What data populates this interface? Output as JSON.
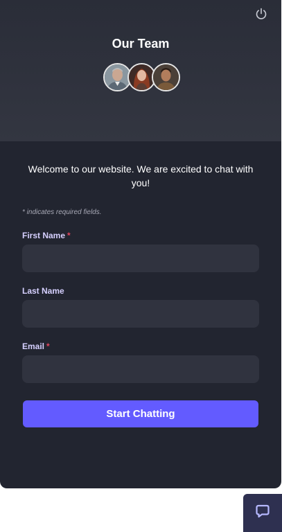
{
  "header": {
    "title": "Our Team",
    "power_icon": "power-icon"
  },
  "welcome_text": "Welcome to our website. We are excited to chat with you!",
  "required_note": "* indicates required fields.",
  "form": {
    "first_name": {
      "label": "First Name",
      "required_mark": "*",
      "value": "",
      "placeholder": ""
    },
    "last_name": {
      "label": "Last Name",
      "value": "",
      "placeholder": ""
    },
    "email": {
      "label": "Email",
      "required_mark": "*",
      "value": "",
      "placeholder": ""
    },
    "submit_label": "Start Chatting"
  },
  "launcher": {
    "icon": "chat-bubble-icon"
  },
  "colors": {
    "panel_bg": "#222530",
    "header_bg": "#333641",
    "input_bg": "#30333f",
    "accent": "#635bff",
    "label_color": "#d6d0ff",
    "required_color": "#e2445c",
    "launcher_bg": "#2e3050",
    "launcher_icon": "#b6b8ff"
  }
}
